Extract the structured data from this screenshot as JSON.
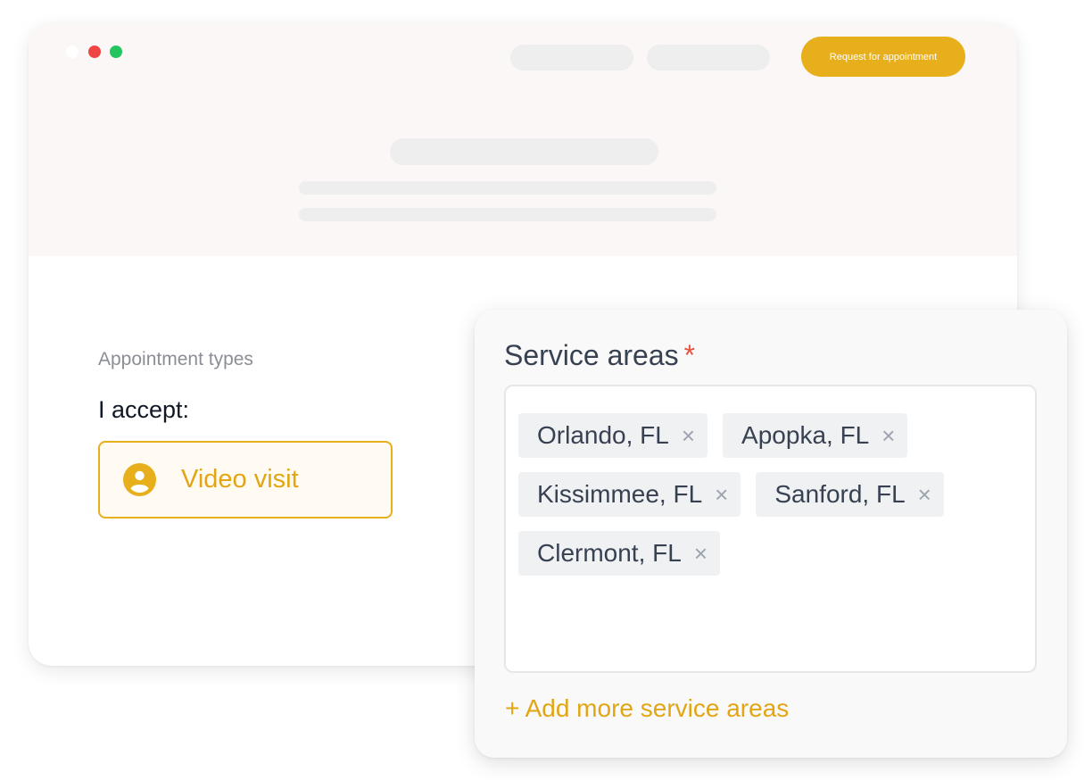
{
  "header": {
    "cta_label": "Request for appointment"
  },
  "appointment": {
    "section_label": "Appointment types",
    "accept_label": "I accept:",
    "option_label": "Video visit",
    "option_icon": "user-circle-icon"
  },
  "service_areas": {
    "title": "Service areas",
    "required_marker": "*",
    "areas": [
      "Orlando, FL",
      "Apopka, FL",
      "Kissimmee, FL",
      "Sanford, FL",
      "Clermont, FL"
    ],
    "remove_glyph": "×",
    "add_more_label": "+ Add more service areas"
  },
  "colors": {
    "accent": "#e8af1c",
    "required": "#e5533d",
    "window_red": "#ef4444",
    "window_green": "#22c55e"
  }
}
